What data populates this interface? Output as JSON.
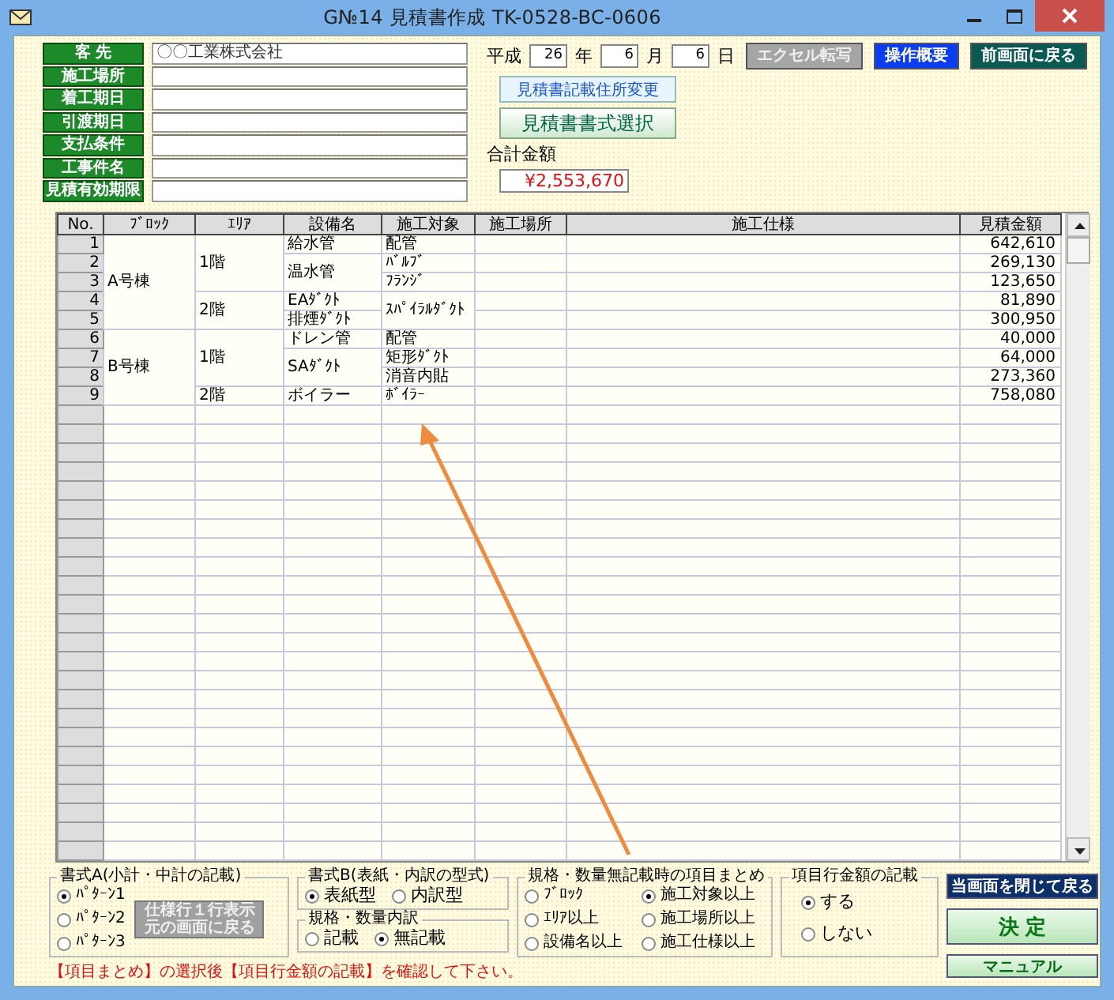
{
  "window": {
    "title": "G№14 見積書作成 TK-0528-BC-0606"
  },
  "fields": [
    {
      "label": "客 先",
      "value": "〇〇工業株式会社"
    },
    {
      "label": "施工場所"
    },
    {
      "label": "着工期日"
    },
    {
      "label": "引渡期日"
    },
    {
      "label": "支払条件"
    },
    {
      "label": "工事件名"
    },
    {
      "label": "見積有効期限"
    }
  ],
  "date": {
    "era": "平成",
    "year": "26",
    "year_unit": "年",
    "month": "6",
    "month_unit": "月",
    "day": "6",
    "day_unit": "日"
  },
  "top_buttons": [
    {
      "label": "エクセル転写",
      "kind": "disabled"
    },
    {
      "label": "操作概要",
      "kind": "info"
    },
    {
      "label": "前画面に戻る",
      "kind": "nav"
    }
  ],
  "address_button": {
    "label": "見積書記載住所変更"
  },
  "format_button": {
    "label": "見積書書式選択"
  },
  "total": {
    "label": "合計金額",
    "value": "¥2,553,670"
  },
  "table": {
    "columns": [
      "No.",
      "ﾌﾞﾛｯｸ",
      "ｴﾘｱ",
      "設備名",
      "施工対象",
      "施工場所",
      "施工仕様",
      "見積金額"
    ],
    "rows": [
      {
        "no": "1",
        "block": "A号棟",
        "area": "1階",
        "equipment": "給水管",
        "target": "配管",
        "amount": "642,610"
      },
      {
        "no": "2",
        "equipment": "温水管",
        "target": "ﾊﾞﾙﾌﾞ",
        "amount": "269,130"
      },
      {
        "no": "3",
        "target": "ﾌﾗﾝｼﾞ",
        "amount": "123,650"
      },
      {
        "no": "4",
        "area": "2階",
        "equipment": "EAﾀﾞｸﾄ",
        "target": "ｽﾊﾟｲﾗﾙﾀﾞｸﾄ",
        "amount": "81,890"
      },
      {
        "no": "5",
        "equipment": "排煙ﾀﾞｸﾄ",
        "amount": "300,950"
      },
      {
        "no": "6",
        "block": "B号棟",
        "area": "1階",
        "equipment": "ドレン管",
        "target": "配管",
        "amount": "40,000"
      },
      {
        "no": "7",
        "equipment": "SAﾀﾞｸﾄ",
        "target": "矩形ﾀﾞｸﾄ",
        "amount": "64,000"
      },
      {
        "no": "8",
        "target": "消音内貼",
        "amount": "273,360"
      },
      {
        "no": "9",
        "area": "2階",
        "equipment": "ボイラー",
        "target": "ﾎﾞｲﾗｰ",
        "amount": "758,080"
      }
    ]
  },
  "format_a": {
    "title": "書式A(小計・中計の記載)",
    "options": [
      {
        "label": "ﾊﾟﾀｰﾝ1",
        "selected": true
      },
      {
        "label": "ﾊﾟﾀｰﾝ2",
        "selected": false
      },
      {
        "label": "ﾊﾟﾀｰﾝ3",
        "selected": false
      }
    ],
    "button": {
      "lines": [
        "仕様行１行表示",
        "元の画面に戻る"
      ],
      "disabled": true
    }
  },
  "format_b": {
    "title": "書式B(表紙・内訳の型式)",
    "options": [
      {
        "label": "表紙型",
        "selected": true
      },
      {
        "label": "内訳型",
        "selected": false
      }
    ]
  },
  "spec_detail": {
    "title": "規格・数量内訳",
    "options": [
      {
        "label": "記載",
        "selected": false
      },
      {
        "label": "無記載",
        "selected": true
      }
    ]
  },
  "grouping": {
    "title": "規格・数量無記載時の項目まとめ",
    "options": [
      {
        "label": "ﾌﾞﾛｯｸ",
        "selected": false
      },
      {
        "label": "施工対象以上",
        "selected": true
      },
      {
        "label": "ｴﾘｱ以上",
        "selected": false
      },
      {
        "label": "施工場所以上",
        "selected": false
      },
      {
        "label": "設備名以上",
        "selected": false
      },
      {
        "label": "施工仕様以上",
        "selected": false
      }
    ]
  },
  "amount_note": {
    "title": "項目行金額の記載",
    "options": [
      {
        "label": "する",
        "selected": true
      },
      {
        "label": "しない",
        "selected": false
      }
    ]
  },
  "side_buttons": [
    {
      "label": "当画面を閉じて戻る",
      "kind": "close"
    },
    {
      "label": "決 定",
      "kind": "confirm"
    },
    {
      "label": "マニュアル",
      "kind": "manual"
    }
  ],
  "note": "【項目まとめ】の選択後【項目行金額の記載】を確認して下さい。"
}
